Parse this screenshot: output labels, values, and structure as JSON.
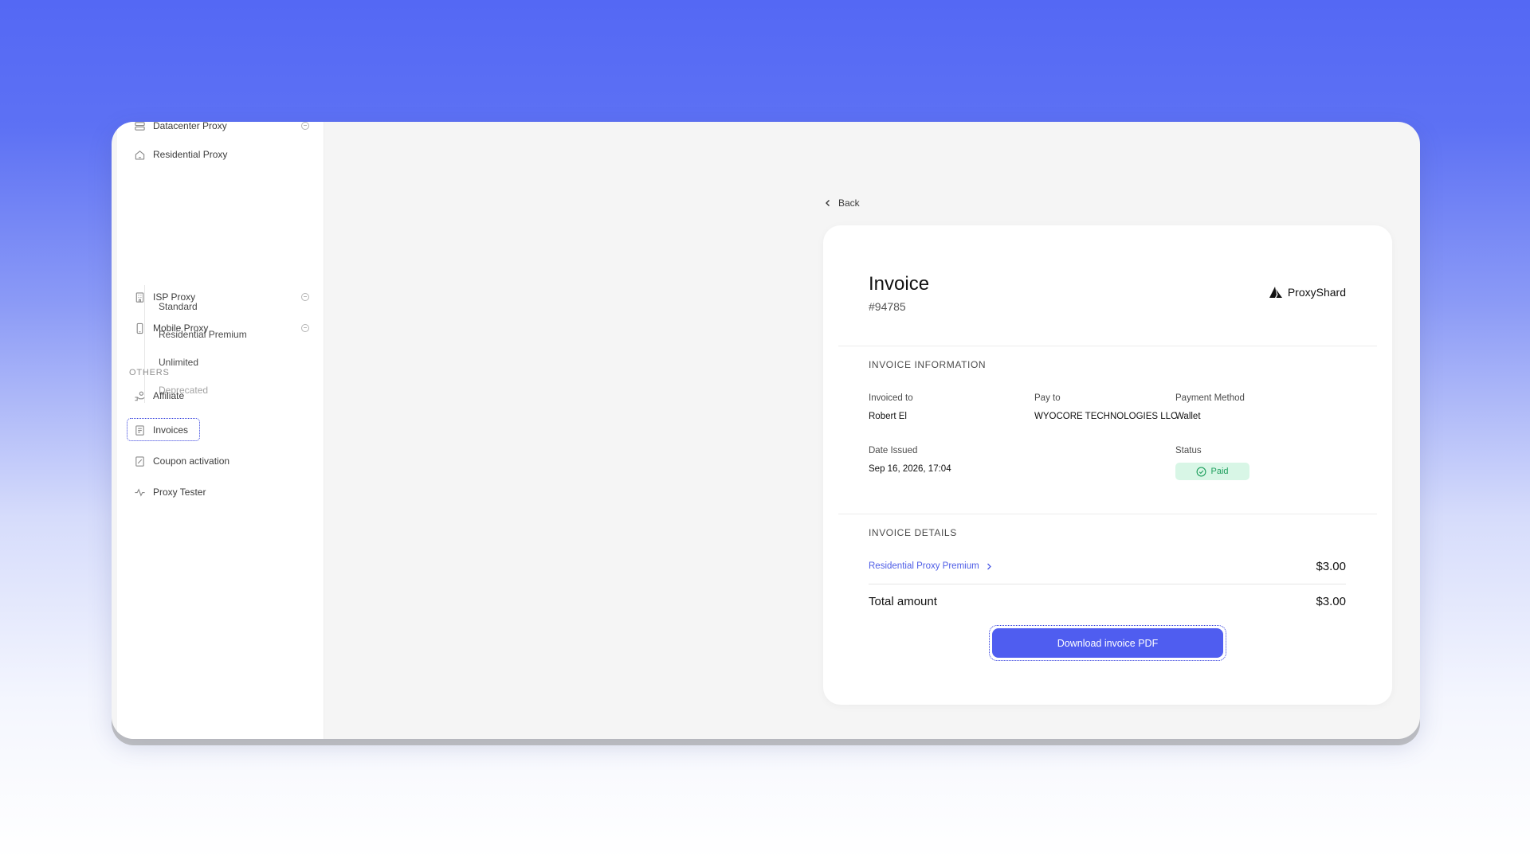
{
  "sidebar": {
    "items": [
      {
        "label": "Datacenter Proxy"
      },
      {
        "label": "Residential Proxy"
      },
      {
        "label": "ISP Proxy"
      },
      {
        "label": "Mobile Proxy"
      }
    ],
    "sub_items": [
      {
        "label": "Standard"
      },
      {
        "label": "Residential Premium"
      },
      {
        "label": "Unlimited"
      },
      {
        "label": "Deprecated"
      }
    ],
    "others_label": "OTHERS",
    "others": [
      {
        "label": "Affiliate"
      },
      {
        "label": "Invoices"
      },
      {
        "label": "Coupon activation"
      },
      {
        "label": "Proxy Tester"
      }
    ]
  },
  "main": {
    "back_label": "Back",
    "invoice": {
      "title": "Invoice",
      "number": "#94785",
      "brand": "ProxyShard",
      "info_heading": "INVOICE INFORMATION",
      "invoiced_to_label": "Invoiced to",
      "invoiced_to_value": "Robert El",
      "pay_to_label": "Pay to",
      "pay_to_value": "WYOCORE TECHNOLOGIES LLC",
      "payment_method_label": "Payment Method",
      "payment_method_value": "Wallet",
      "date_issued_label": "Date Issued",
      "date_issued_value": "Sep 16, 2026, 17:04",
      "status_label": "Status",
      "status_value": "Paid",
      "details_heading": "INVOICE DETAILS",
      "line_item_label": "Residential Proxy Premium",
      "line_item_amount": "$3.00",
      "total_label": "Total amount",
      "total_amount": "$3.00",
      "download_label": "Download invoice PDF"
    }
  },
  "colors": {
    "accent": "#4f5df0",
    "link": "#4d5ce6",
    "status_bg": "#d8f6e6",
    "status_text": "#1f9f5e"
  }
}
